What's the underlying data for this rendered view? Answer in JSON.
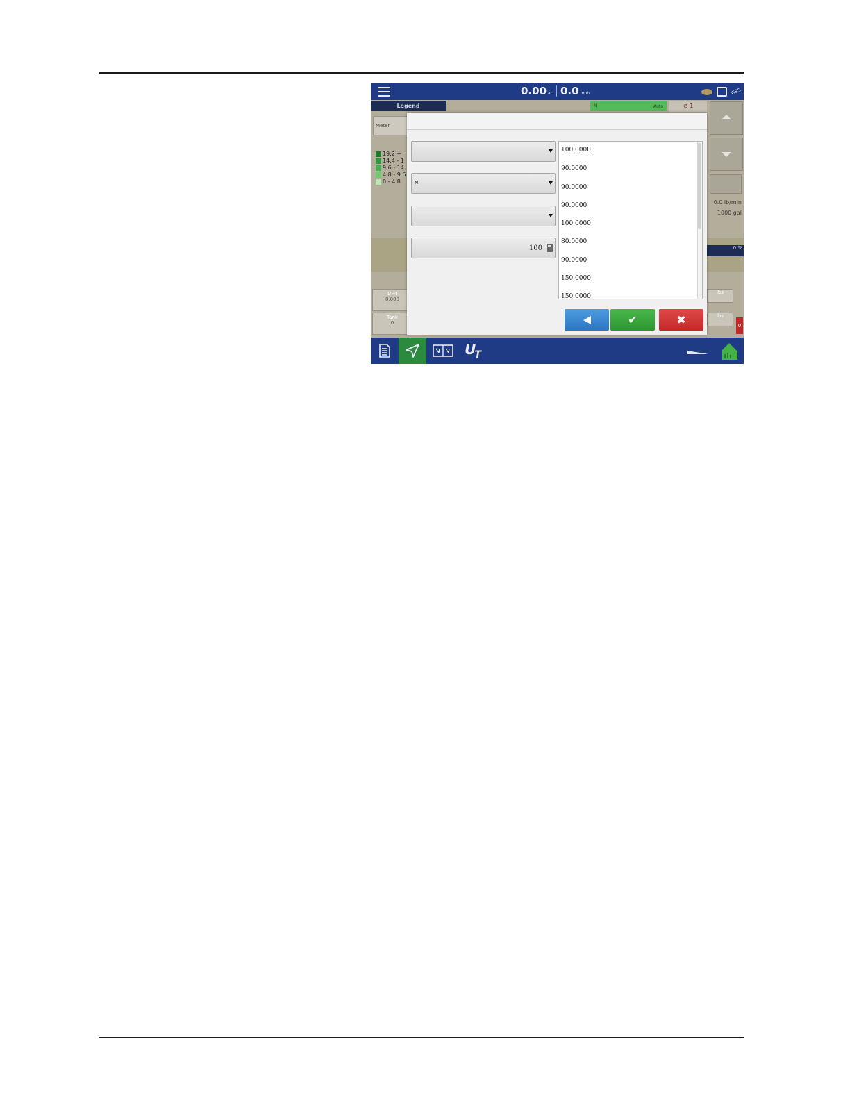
{
  "topbar": {
    "area_value": "0.00",
    "area_unit": "ac",
    "speed_value": "0.0",
    "speed_unit": "mph",
    "gps_label": "GPS"
  },
  "background": {
    "legend_tab": "Legend",
    "monitor_button": "Meter",
    "legend_items": [
      {
        "label": "19.2 +",
        "color": "#1f7a2a"
      },
      {
        "label": "14.4 - 1",
        "color": "#2e9a3a"
      },
      {
        "label": "9.6 - 14",
        "color": "#44b24e"
      },
      {
        "label": "4.8 - 9.6",
        "color": "#6fcc6e"
      },
      {
        "label": "0 - 4.8",
        "color": "#b7e8b4"
      }
    ],
    "product_tag": "N",
    "product_status": "Auto",
    "alarm_count": "1",
    "rate_line1": "0.0 lb/min",
    "rate_line2": "1000 gal",
    "percent": "0 %",
    "cell1_label": "DF4",
    "cell1_value": "0.000",
    "cell2_label": "Tank",
    "cell2_value": "0",
    "right_cell1": "lbs",
    "right_cell2": "lbs",
    "red_badge": "0"
  },
  "dialog": {
    "dropdown1_value": "",
    "dropdown2_value": "N",
    "dropdown3_value": "",
    "number_value": "100",
    "list_items": [
      "100.0000",
      "90.0000",
      "90.0000",
      "90.0000",
      "100.0000",
      "80.0000",
      "90.0000",
      "150.0000",
      "150.0000"
    ]
  },
  "colors": {
    "topbar": "#1f3b85",
    "back_button": "#2c76c2",
    "ok_button": "#2c9530",
    "cancel_button": "#c42727"
  }
}
